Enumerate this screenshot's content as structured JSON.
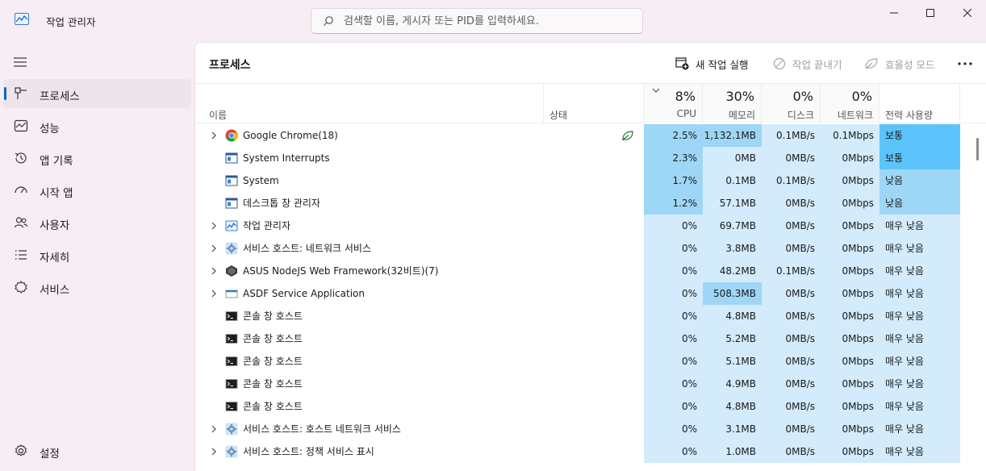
{
  "app": {
    "title": "작업 관리자"
  },
  "search": {
    "placeholder": "검색할 이름, 게시자 또는 PID를 입력하세요."
  },
  "sidebar": {
    "items": [
      {
        "label": "프로세스",
        "icon": "processes-icon",
        "active": true
      },
      {
        "label": "성능",
        "icon": "performance-icon"
      },
      {
        "label": "앱 기록",
        "icon": "app-history-icon"
      },
      {
        "label": "시작 앱",
        "icon": "startup-apps-icon"
      },
      {
        "label": "사용자",
        "icon": "users-icon"
      },
      {
        "label": "자세히",
        "icon": "details-icon"
      },
      {
        "label": "서비스",
        "icon": "services-icon"
      }
    ],
    "settings_label": "설정"
  },
  "page": {
    "title": "프로세스",
    "run_task_label": "새 작업 실행",
    "end_task_label": "작업 끝내기",
    "efficiency_label": "효율성 모드"
  },
  "columns": {
    "name": "이름",
    "status": "상태",
    "cpu": {
      "pct": "8%",
      "label": "CPU"
    },
    "memory": {
      "pct": "30%",
      "label": "메모리"
    },
    "disk": {
      "pct": "0%",
      "label": "디스크"
    },
    "network": {
      "pct": "0%",
      "label": "네트워크"
    },
    "power": "전력 사용량"
  },
  "processes": [
    {
      "name": "Google Chrome(18)",
      "icon": "chrome-icon",
      "expandable": true,
      "status_icon": "efficiency-leaf-icon",
      "cpu": "2.5%",
      "memory": "1,132.1MB",
      "disk": "0.1MB/s",
      "network": "0.1Mbps",
      "power": "보통"
    },
    {
      "name": "System Interrupts",
      "icon": "system-window-icon",
      "expandable": false,
      "cpu": "2.3%",
      "memory": "0MB",
      "disk": "0MB/s",
      "network": "0Mbps",
      "power": "보통"
    },
    {
      "name": "System",
      "icon": "system-window-icon",
      "expandable": false,
      "cpu": "1.7%",
      "memory": "0.1MB",
      "disk": "0.1MB/s",
      "network": "0Mbps",
      "power": "낮음"
    },
    {
      "name": "데스크톱 창 관리자",
      "icon": "system-window-icon",
      "expandable": false,
      "cpu": "1.2%",
      "memory": "57.1MB",
      "disk": "0MB/s",
      "network": "0Mbps",
      "power": "낮음"
    },
    {
      "name": "작업 관리자",
      "icon": "task-manager-icon",
      "expandable": true,
      "cpu": "0%",
      "memory": "69.7MB",
      "disk": "0MB/s",
      "network": "0Mbps",
      "power": "매우 낮음"
    },
    {
      "name": "서비스 호스트: 네트워크 서비스",
      "icon": "gear-icon",
      "expandable": true,
      "cpu": "0%",
      "memory": "3.8MB",
      "disk": "0MB/s",
      "network": "0Mbps",
      "power": "매우 낮음"
    },
    {
      "name": "ASUS NodeJS Web Framework(32비트)(7)",
      "icon": "asus-icon",
      "expandable": true,
      "cpu": "0%",
      "memory": "48.2MB",
      "disk": "0.1MB/s",
      "network": "0Mbps",
      "power": "매우 낮음"
    },
    {
      "name": "ASDF Service Application",
      "icon": "app-window-icon",
      "expandable": true,
      "cpu": "0%",
      "memory": "508.3MB",
      "disk": "0MB/s",
      "network": "0Mbps",
      "power": "매우 낮음"
    },
    {
      "name": "콘솔 창 호스트",
      "icon": "console-icon",
      "expandable": false,
      "cpu": "0%",
      "memory": "4.8MB",
      "disk": "0MB/s",
      "network": "0Mbps",
      "power": "매우 낮음"
    },
    {
      "name": "콘솔 창 호스트",
      "icon": "console-icon",
      "expandable": false,
      "cpu": "0%",
      "memory": "5.2MB",
      "disk": "0MB/s",
      "network": "0Mbps",
      "power": "매우 낮음"
    },
    {
      "name": "콘솔 창 호스트",
      "icon": "console-icon",
      "expandable": false,
      "cpu": "0%",
      "memory": "5.1MB",
      "disk": "0MB/s",
      "network": "0Mbps",
      "power": "매우 낮음"
    },
    {
      "name": "콘솔 창 호스트",
      "icon": "console-icon",
      "expandable": false,
      "cpu": "0%",
      "memory": "4.9MB",
      "disk": "0MB/s",
      "network": "0Mbps",
      "power": "매우 낮음"
    },
    {
      "name": "콘솔 창 호스트",
      "icon": "console-icon",
      "expandable": false,
      "cpu": "0%",
      "memory": "4.8MB",
      "disk": "0MB/s",
      "network": "0Mbps",
      "power": "매우 낮음"
    },
    {
      "name": "서비스 호스트: 호스트 네트워크 서비스",
      "icon": "gear-icon",
      "expandable": true,
      "cpu": "0%",
      "memory": "3.1MB",
      "disk": "0MB/s",
      "network": "0Mbps",
      "power": "매우 낮음"
    },
    {
      "name": "서비스 호스트: 정책 서비스 표시",
      "icon": "gear-icon",
      "expandable": true,
      "cpu": "0%",
      "memory": "1.0MB",
      "disk": "0MB/s",
      "network": "0Mbps",
      "power": "매우 낮음"
    }
  ],
  "colors": {
    "heat_light": "#d3ebfb",
    "heat_medium": "#9ed6f6",
    "heat_strong": "#5dc4fb",
    "accent": "#0067c0"
  }
}
